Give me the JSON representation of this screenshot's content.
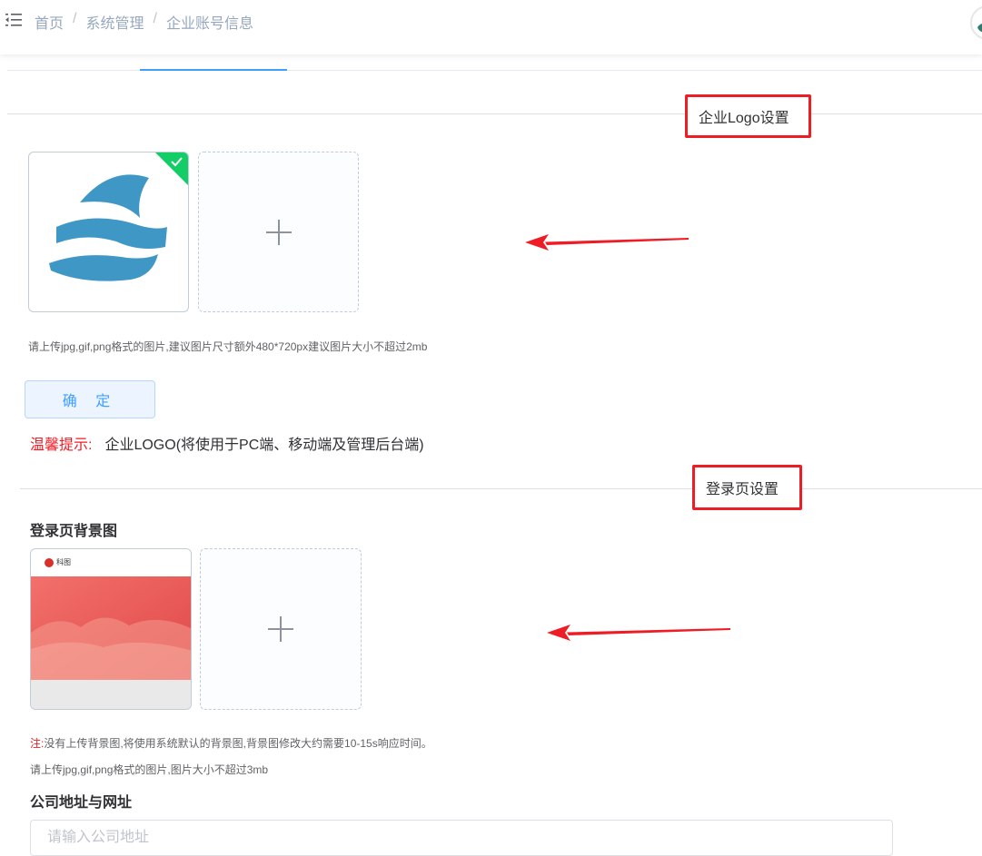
{
  "breadcrumb": {
    "items": [
      "首页",
      "系统管理",
      "企业账号信息"
    ],
    "separator": "/"
  },
  "icons": {
    "menu": "menu-fold-icon",
    "avatar": "user-avatar",
    "plus": "plus-icon",
    "check": "check-icon",
    "arrow": "red-arrow-left-icon"
  },
  "colors": {
    "annotation_red": "#ee1c25",
    "primary": "#409eff",
    "logo_blue": "#3f97c6",
    "success_badge": "#13ce66"
  },
  "logo_section": {
    "title": "企业Logo设置",
    "hint": "请上传jpg,gif,png格式的图片,建议图片尺寸额外480*720px建议图片大小不超过2mb",
    "confirm_button": "确 定",
    "tip_label": "温馨提示:",
    "tip_text": "企业LOGO(将使用于PC端、移动端及管理后台端)"
  },
  "login_section": {
    "title": "登录页设置",
    "background_title": "登录页背景图",
    "note_label": "注:",
    "note_text": "没有上传背景图,将使用系统默认的背景图,背景图修改大约需要10-15s响应时间。",
    "hint": "请上传jpg,gif,png格式的图片,图片大小不超过3mb",
    "preview_brand": "科图"
  },
  "address_section": {
    "title": "公司地址与网址",
    "address_placeholder": "请输入公司地址"
  }
}
